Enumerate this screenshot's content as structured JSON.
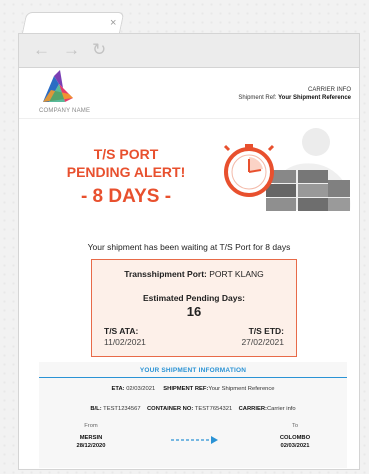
{
  "browser": {
    "close_glyph": "×",
    "nav": {
      "back": "←",
      "forward": "→",
      "reload": "↻"
    }
  },
  "header": {
    "company_name": "COMPANY NAME",
    "carrier_info": "CARRIER INFO",
    "shipment_ref_label": "Shipment Ref:",
    "shipment_ref_value": "Your Shipment Reference"
  },
  "alert": {
    "line1": "T/S PORT",
    "line2": "PENDING ALERT!",
    "days": "- 8 DAYS -"
  },
  "message": "Your shipment has been waiting at T/S Port for 8 days",
  "summary": {
    "port_label": "Transshipment Port:",
    "port_value": "PORT KLANG",
    "pending_label": "Estimated Pending Days:",
    "pending_value": "16",
    "ata_label": "T/S ATA:",
    "ata_value": "11/02/2021",
    "etd_label": "T/S ETD:",
    "etd_value": "27/02/2021"
  },
  "info": {
    "title": "YOUR SHIPMENT INFORMATION",
    "eta_label": "ETA:",
    "eta_value": "02/03/2021",
    "shipref_label": "SHIPMENT REF:",
    "shipref_value": "Your Shipment Reference",
    "bl_label": "B/L:",
    "bl_value": "TEST1234567",
    "container_label": "CONTAINER NO:",
    "container_value": "TEST7654321",
    "carrier_label": "CARRIER:",
    "carrier_value": "Carrier info",
    "from_label": "From",
    "from_city": "MERSIN",
    "from_date": "28/12/2020",
    "to_label": "To",
    "to_city": "COLOMBO",
    "to_date": "02/03/2021"
  },
  "colors": {
    "accent": "#e8502e",
    "info_blue": "#2a93d5",
    "box_bg": "#fdf0e9"
  }
}
